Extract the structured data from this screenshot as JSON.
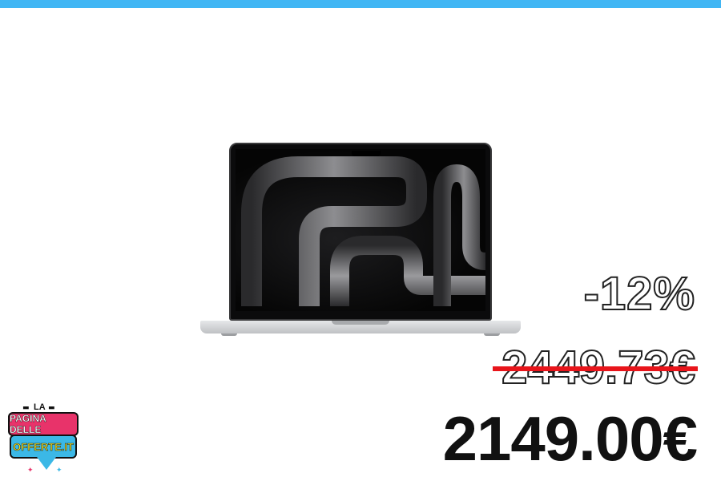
{
  "product": {
    "image_name": "laptop-image"
  },
  "pricing": {
    "discount": "-12%",
    "old_price": "2449.73€",
    "new_price": "2149.00€"
  },
  "logo": {
    "top_text": "LA",
    "line1": "PAGINA DELLE",
    "line2": "OFFERTE.IT"
  },
  "colors": {
    "top_bar": "#41b6f4",
    "strike": "#e8151b",
    "logo_pink": "#e8336a",
    "logo_blue": "#3bb8e6",
    "logo_yellow": "#f6e11d"
  }
}
